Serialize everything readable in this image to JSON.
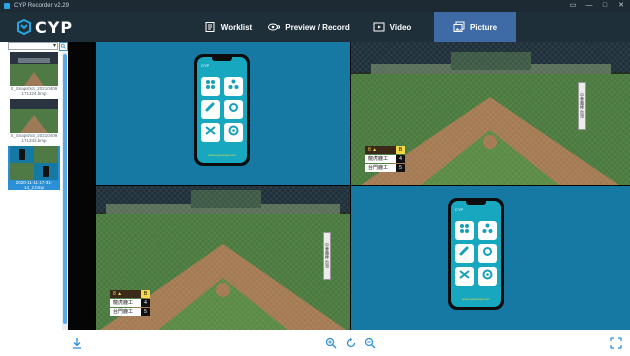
{
  "window": {
    "title": "CYP Recorder v2.29",
    "controls": [
      "▭",
      "—",
      "□",
      "✕"
    ]
  },
  "brand": {
    "name": "CYP",
    "accent": "#2aa7e0"
  },
  "tabs": [
    {
      "label": "Worklist",
      "icon": "worklist-icon",
      "active": false
    },
    {
      "label": "Preview / Record",
      "icon": "preview-record-icon",
      "active": false
    },
    {
      "label": "Video",
      "icon": "video-icon",
      "active": false
    },
    {
      "label": "Picture",
      "icon": "picture-icon",
      "active": true
    }
  ],
  "sidebar": {
    "filter_value": "",
    "filter_arrow": "▾",
    "thumbnails": [
      {
        "caption": "0_Snapshot_20210409 171324.bmp",
        "selected": false
      },
      {
        "caption": "0_Snapshot_20210409 171333.bmp",
        "selected": false
      },
      {
        "caption": "2020-11-11 17-31-14_2.bmp",
        "selected": true
      }
    ]
  },
  "preview": {
    "phone_app": {
      "title": "CYP",
      "tiles": [
        "Matrix",
        "Scenarios",
        "Switchers",
        "Settings",
        "Switchers",
        "Help"
      ],
      "footer": "www.cypeurope.com"
    },
    "scoreboard": {
      "inning": "8 ▲",
      "count": "B",
      "rows": [
        {
          "team": "龍虎鹿工",
          "score": "4"
        },
        {
          "team": "台門鹿工",
          "score": "5"
        }
      ]
    },
    "banner_text": "中華職棒 台灣",
    "colors": {
      "teal": "#1679a3",
      "stage": "#050505",
      "active_tab": "#3e6aa6",
      "header": "#1f2f3a"
    }
  },
  "toolbar": {
    "download": "download-icon",
    "zoom_in": "zoom-in-icon",
    "rotate": "rotate-icon",
    "zoom_out": "zoom-out-icon",
    "fullscreen": "fullscreen-icon"
  }
}
